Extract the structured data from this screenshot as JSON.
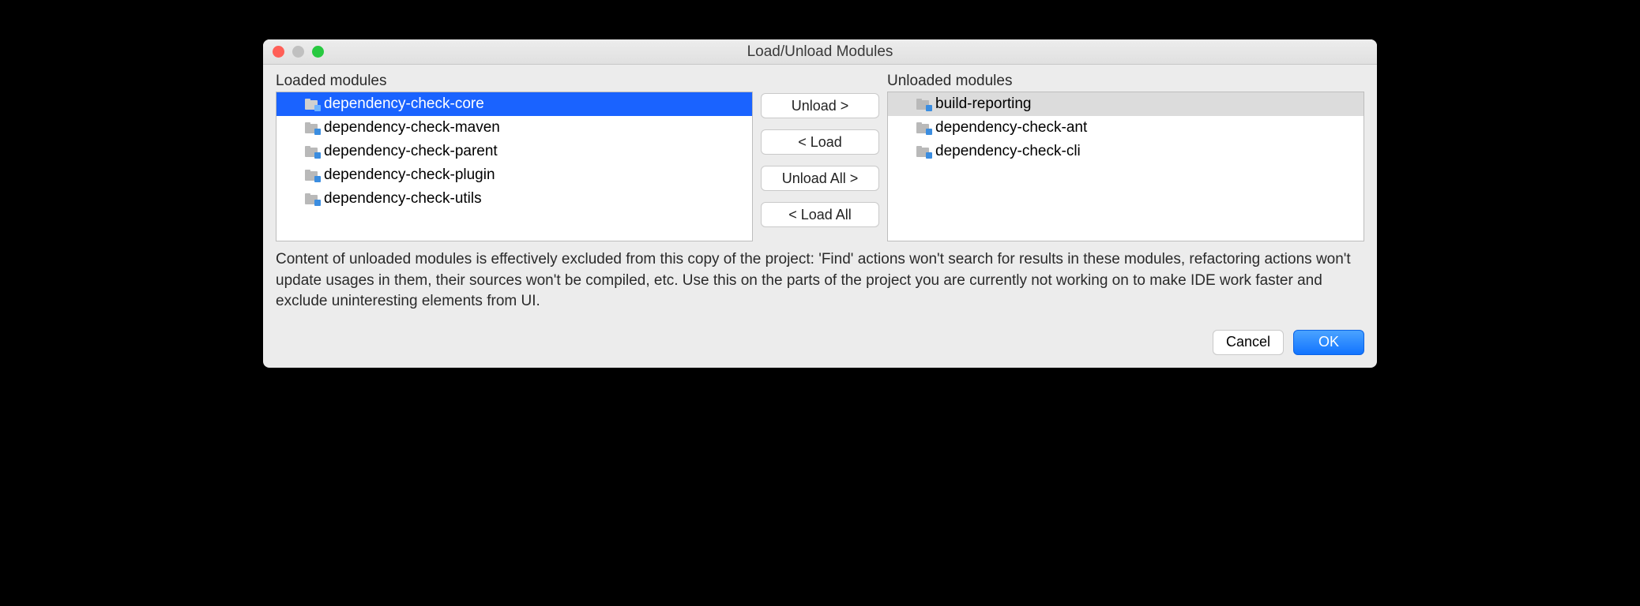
{
  "title": "Load/Unload Modules",
  "panes": {
    "loaded_label": "Loaded modules",
    "unloaded_label": "Unloaded modules",
    "loaded": [
      {
        "label": "dependency-check-core",
        "selected": true
      },
      {
        "label": "dependency-check-maven",
        "selected": false
      },
      {
        "label": "dependency-check-parent",
        "selected": false
      },
      {
        "label": "dependency-check-plugin",
        "selected": false
      },
      {
        "label": "dependency-check-utils",
        "selected": false
      }
    ],
    "unloaded": [
      {
        "label": "build-reporting",
        "selected_soft": true
      },
      {
        "label": "dependency-check-ant",
        "selected_soft": false
      },
      {
        "label": "dependency-check-cli",
        "selected_soft": false
      }
    ]
  },
  "buttons": {
    "unload": "Unload >",
    "load": "< Load",
    "unload_all": "Unload All >",
    "load_all": "< Load All"
  },
  "description": "Content of unloaded modules is effectively excluded from this copy of the project: 'Find' actions won't search for results in these modules, refactoring actions won't update usages in them, their sources won't be compiled, etc. Use this on the parts of the project you are currently not working on to make IDE work faster and exclude uninteresting elements from UI.",
  "footer": {
    "cancel": "Cancel",
    "ok": "OK"
  }
}
